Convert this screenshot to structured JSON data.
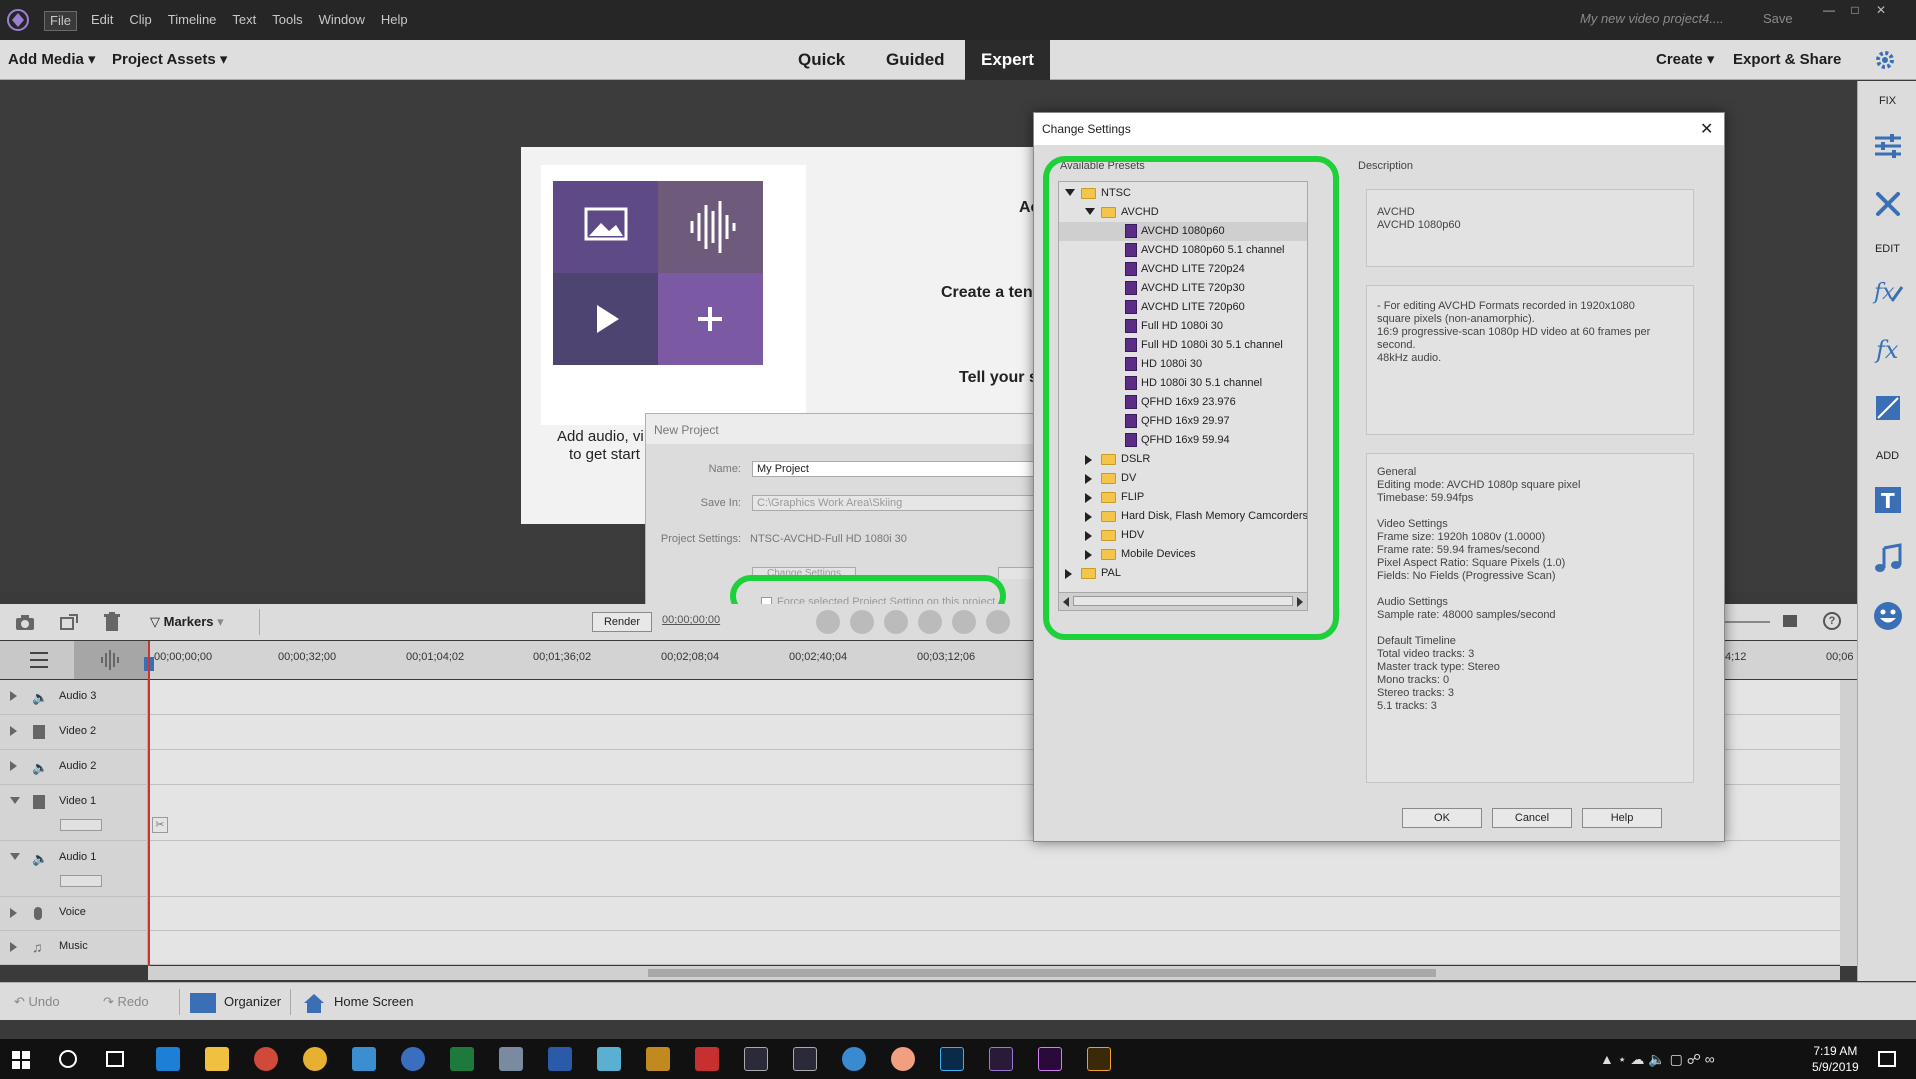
{
  "titlebar": {
    "menu": [
      "File",
      "Edit",
      "Clip",
      "Timeline",
      "Text",
      "Tools",
      "Window",
      "Help"
    ],
    "project_name": "My new video project4....",
    "save": "Save"
  },
  "modebar": {
    "add_media": "Add Media",
    "project_assets": "Project Assets",
    "tabs": [
      "Quick",
      "Guided",
      "Expert"
    ],
    "active_tab": "Expert",
    "create": "Create",
    "export_share": "Export & Share"
  },
  "rightpanel": {
    "fix": "FIX",
    "edit": "EDIT",
    "add": "ADD"
  },
  "welcome": {
    "line1": "Ac",
    "line2": "Create a ten",
    "line3": "Tell your s",
    "hint1": "Add audio, vi",
    "hint2": "to get start"
  },
  "new_project": {
    "title": "New Project",
    "name_label": "Name:",
    "name_value": "My Project",
    "save_in_label": "Save In:",
    "save_in_value": "C:\\Graphics Work Area\\Skiing",
    "settings_label": "Project Settings:",
    "settings_value": "NTSC-AVCHD-Full HD 1080i 30",
    "change_settings": "Change Settings",
    "force_checkbox": "Force selected Project Setting on this project"
  },
  "change_settings": {
    "title": "Change Settings",
    "presets_label": "Available Presets",
    "description_label": "Description",
    "tree": [
      {
        "label": "NTSC",
        "level": 0,
        "type": "folder",
        "state": "open"
      },
      {
        "label": "AVCHD",
        "level": 1,
        "type": "folder",
        "state": "open"
      },
      {
        "label": "AVCHD 1080p60",
        "level": 2,
        "type": "preset",
        "selected": true
      },
      {
        "label": "AVCHD 1080p60 5.1 channel",
        "level": 2,
        "type": "preset"
      },
      {
        "label": "AVCHD LITE 720p24",
        "level": 2,
        "type": "preset"
      },
      {
        "label": "AVCHD LITE 720p30",
        "level": 2,
        "type": "preset"
      },
      {
        "label": "AVCHD LITE 720p60",
        "level": 2,
        "type": "preset"
      },
      {
        "label": "Full HD 1080i 30",
        "level": 2,
        "type": "preset"
      },
      {
        "label": "Full HD 1080i 30 5.1 channel",
        "level": 2,
        "type": "preset"
      },
      {
        "label": "HD 1080i 30",
        "level": 2,
        "type": "preset"
      },
      {
        "label": "HD 1080i 30 5.1 channel",
        "level": 2,
        "type": "preset"
      },
      {
        "label": "QFHD 16x9 23.976",
        "level": 2,
        "type": "preset"
      },
      {
        "label": "QFHD 16x9 29.97",
        "level": 2,
        "type": "preset"
      },
      {
        "label": "QFHD 16x9 59.94",
        "level": 2,
        "type": "preset"
      },
      {
        "label": "DSLR",
        "level": 1,
        "type": "folder",
        "state": "closed"
      },
      {
        "label": "DV",
        "level": 1,
        "type": "folder",
        "state": "closed"
      },
      {
        "label": "FLIP",
        "level": 1,
        "type": "folder",
        "state": "closed"
      },
      {
        "label": "Hard Disk, Flash Memory Camcorders",
        "level": 1,
        "type": "folder",
        "state": "closed"
      },
      {
        "label": "HDV",
        "level": 1,
        "type": "folder",
        "state": "closed"
      },
      {
        "label": "Mobile Devices",
        "level": 1,
        "type": "folder",
        "state": "closed"
      },
      {
        "label": "PAL",
        "level": 0,
        "type": "folder",
        "state": "closed"
      }
    ],
    "desc_box1": [
      "AVCHD",
      "AVCHD 1080p60"
    ],
    "desc_box2": [
      "- For editing AVCHD Formats recorded in 1920x1080",
      "square pixels (non-anamorphic).",
      "16:9 progressive-scan 1080p HD video at 60 frames per",
      "second.",
      "48kHz audio."
    ],
    "desc_box3": [
      "General",
      " Editing mode: AVCHD 1080p square pixel",
      " Timebase: 59.94fps",
      "",
      "Video Settings",
      " Frame size: 1920h 1080v (1.0000)",
      " Frame rate: 59.94 frames/second",
      " Pixel Aspect Ratio: Square Pixels (1.0)",
      " Fields: No Fields (Progressive Scan)",
      "",
      "Audio Settings",
      " Sample rate: 48000 samples/second",
      "",
      "Default Timeline",
      " Total video tracks: 3",
      " Master track type: Stereo",
      " Mono tracks: 0",
      " Stereo tracks: 3",
      " 5.1 tracks: 3"
    ],
    "ok": "OK",
    "cancel": "Cancel",
    "help": "Help"
  },
  "timeline": {
    "markers": "Markers",
    "render": "Render",
    "timecode": "00;00;00;00",
    "ruler": [
      "00;00;00;00",
      "00;00;32;00",
      "00;01;04;02",
      "00;01;36;02",
      "00;02;08;04",
      "00;02;40;04",
      "00;03;12;06",
      "4;12",
      "00;06"
    ],
    "tracks": [
      {
        "name": "Audio 3",
        "kind": "audio"
      },
      {
        "name": "Video 2",
        "kind": "video"
      },
      {
        "name": "Audio 2",
        "kind": "audio"
      },
      {
        "name": "Video 1",
        "kind": "video"
      },
      {
        "name": "Audio 1",
        "kind": "audio"
      },
      {
        "name": "Voice",
        "kind": "voice"
      },
      {
        "name": "Music",
        "kind": "music"
      }
    ]
  },
  "bottombar": {
    "undo": "Undo",
    "redo": "Redo",
    "organizer": "Organizer",
    "home_screen": "Home Screen"
  },
  "taskbar": {
    "time": "7:19 AM",
    "date": "5/9/2019"
  },
  "colors": {
    "highlight": "#1ed03a",
    "accent_purple": "#6f4a9c",
    "dialog_bg": "#dddddd"
  }
}
